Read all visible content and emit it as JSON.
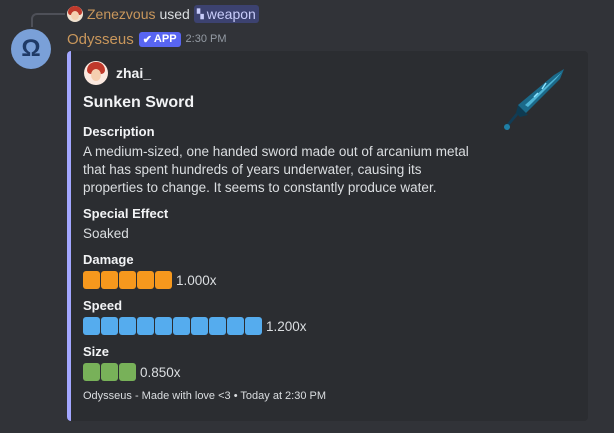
{
  "reply": {
    "user": "Zenezvous",
    "verb": "used",
    "command": "weapon",
    "command_icon": "command-icon"
  },
  "message": {
    "author": "Odysseus",
    "badge": "APP",
    "timestamp": "2:30 PM",
    "avatar_glyph": "Ω"
  },
  "embed": {
    "accent_color": "#a3a7ff",
    "author": "zhai_",
    "title": "Sunken Sword",
    "thumbnail": "sword-thumbnail",
    "description_label": "Description",
    "description": "A medium-sized, one handed sword made out of arcanium metal that has spent hundreds of years underwater, causing its properties to change. It seems to constantly produce water.",
    "special_label": "Special Effect",
    "special_value": "Soaked",
    "stats": [
      {
        "label": "Damage",
        "value": "1.000x",
        "segments": 5,
        "color": "#f6981d"
      },
      {
        "label": "Speed",
        "value": "1.200x",
        "segments": 10,
        "color": "#55acee"
      },
      {
        "label": "Size",
        "value": "0.850x",
        "segments": 3,
        "color": "#78b159"
      }
    ],
    "footer": "Odysseus - Made with love <3 • Today at 2:30 PM"
  }
}
